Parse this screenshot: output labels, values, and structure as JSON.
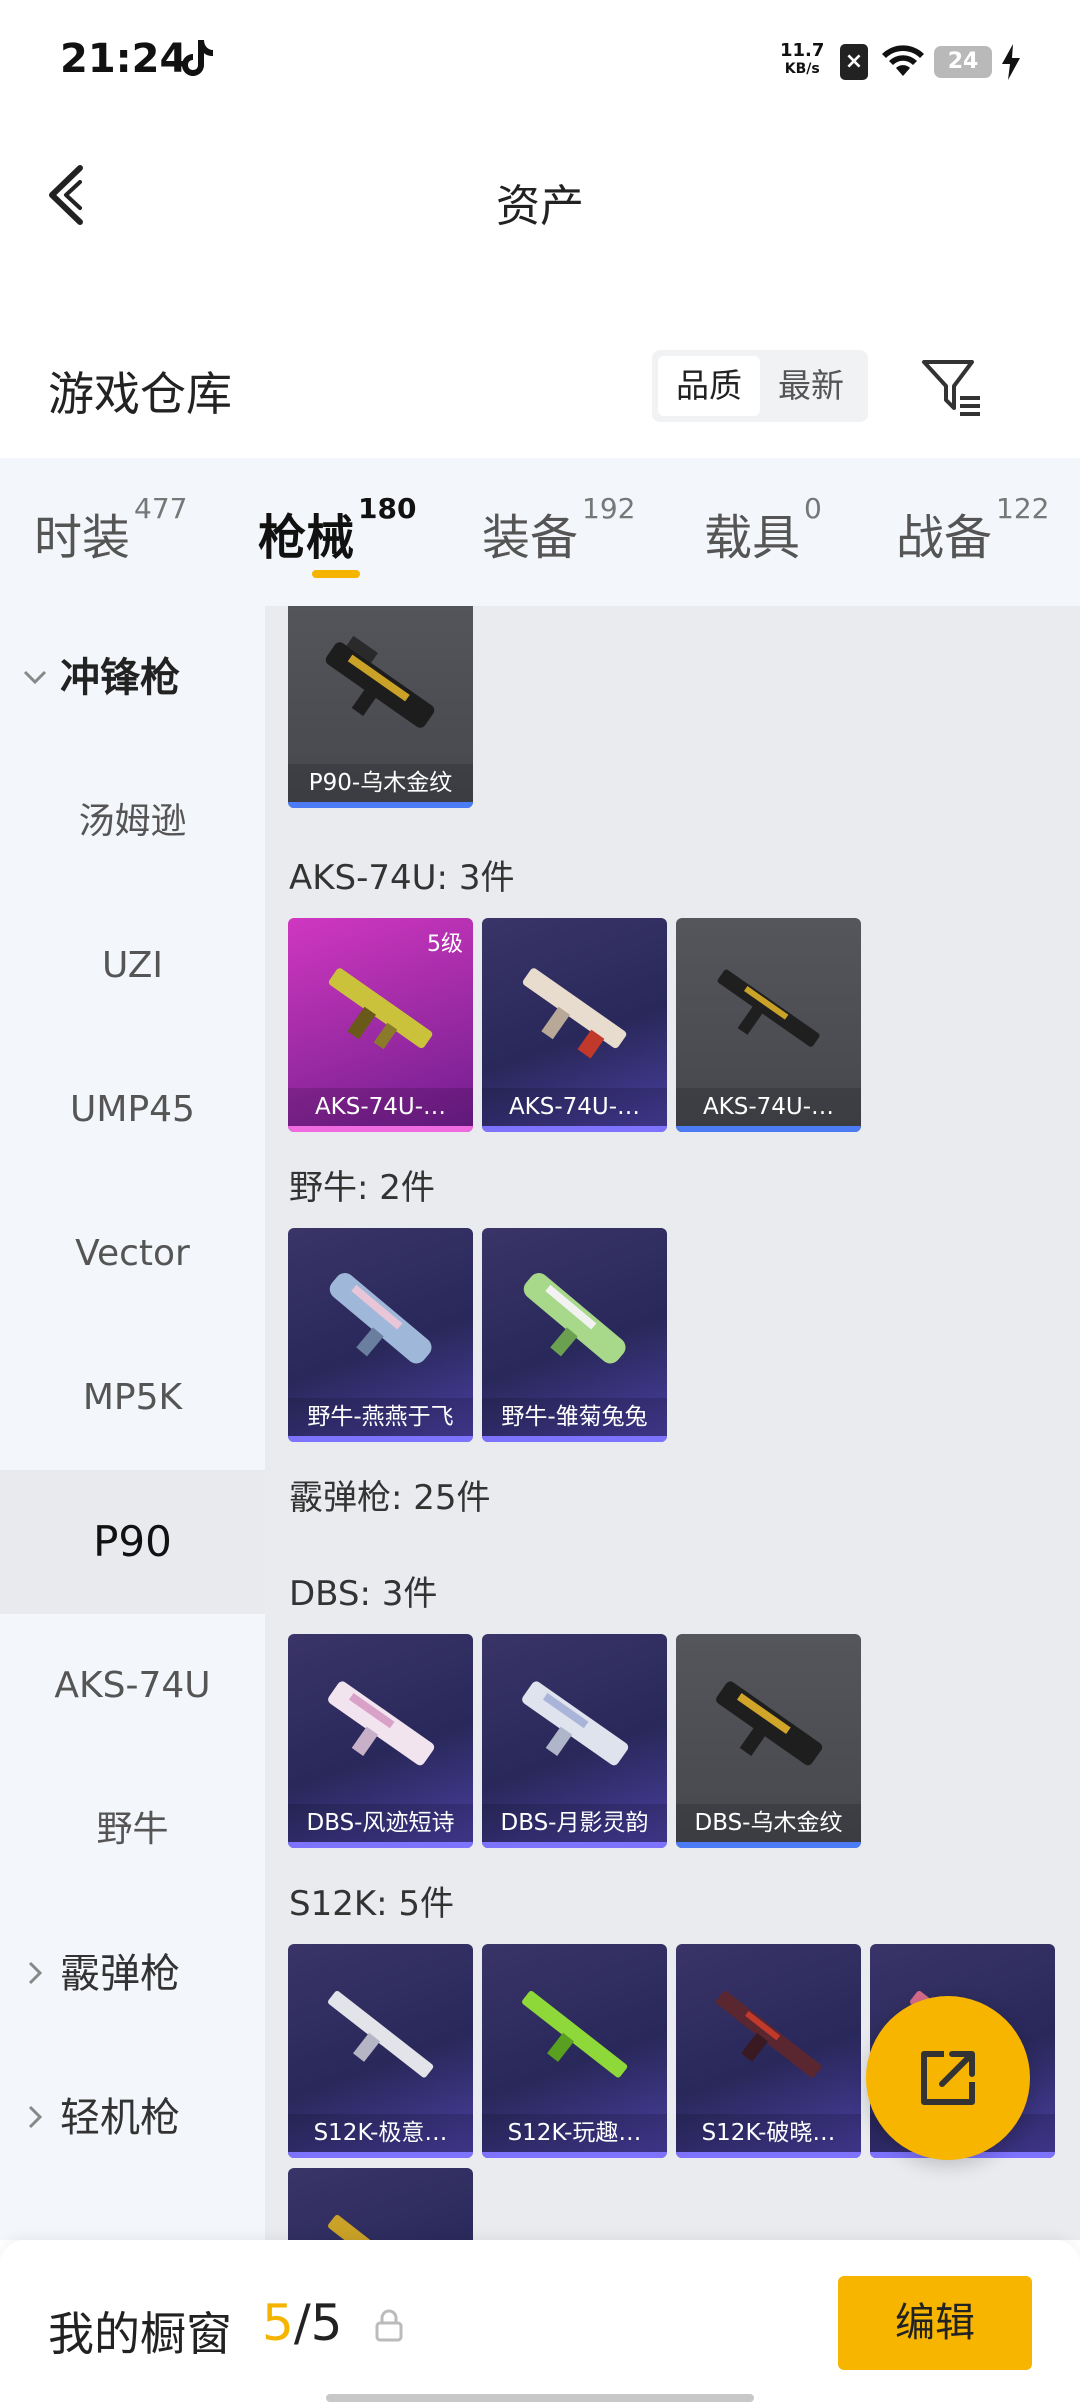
{
  "status": {
    "time": "21:24",
    "net_speed_value": "11.7",
    "net_speed_unit": "KB/s",
    "battery": "24"
  },
  "header": {
    "title": "资产",
    "back_icon": "back-arrow-icon"
  },
  "section": {
    "title": "游戏仓库",
    "sort_options": [
      "品质",
      "最新"
    ],
    "sort_selected": "品质"
  },
  "tabs": [
    {
      "label": "时装",
      "count": "477",
      "active": false
    },
    {
      "label": "枪械",
      "count": "180",
      "active": true
    },
    {
      "label": "装备",
      "count": "192",
      "active": false
    },
    {
      "label": "载具",
      "count": "0",
      "active": false
    },
    {
      "label": "战备",
      "count": "122",
      "active": false
    }
  ],
  "sidebar": {
    "items": [
      {
        "label": "冲锋枪",
        "type": "group-expanded"
      },
      {
        "label": "汤姆逊",
        "type": "item"
      },
      {
        "label": "UZI",
        "type": "item"
      },
      {
        "label": "UMP45",
        "type": "item"
      },
      {
        "label": "Vector",
        "type": "item"
      },
      {
        "label": "MP5K",
        "type": "item"
      },
      {
        "label": "P90",
        "type": "selected"
      },
      {
        "label": "AKS-74U",
        "type": "item"
      },
      {
        "label": "野牛",
        "type": "item"
      },
      {
        "label": "霰弹枪",
        "type": "group-collapsed"
      },
      {
        "label": "轻机枪",
        "type": "group-collapsed"
      }
    ]
  },
  "groups": {
    "p90": {
      "cards": [
        {
          "name": "P90-乌木金纹",
          "rarity": "gray"
        }
      ]
    },
    "aks": {
      "label": "AKS-74U: 3件",
      "cards": [
        {
          "name": "AKS-74U-…",
          "rarity": "pink",
          "level": "5级"
        },
        {
          "name": "AKS-74U-…",
          "rarity": "purple"
        },
        {
          "name": "AKS-74U-…",
          "rarity": "gray"
        }
      ]
    },
    "bison": {
      "label": "野牛: 2件",
      "cards": [
        {
          "name": "野牛-燕燕于飞",
          "rarity": "purple"
        },
        {
          "name": "野牛-雏菊兔兔",
          "rarity": "purple"
        }
      ]
    },
    "shotgun": {
      "label": "霰弹枪: 25件"
    },
    "dbs": {
      "label": "DBS: 3件",
      "cards": [
        {
          "name": "DBS-风迹短诗",
          "rarity": "purple"
        },
        {
          "name": "DBS-月影灵韵",
          "rarity": "purple"
        },
        {
          "name": "DBS-乌木金纹",
          "rarity": "gray"
        }
      ]
    },
    "s12k": {
      "label": "S12K: 5件",
      "cards": [
        {
          "name": "S12K-极意…",
          "rarity": "purple"
        },
        {
          "name": "S12K-玩趣…",
          "rarity": "purple"
        },
        {
          "name": "S12K-破晓…",
          "rarity": "purple"
        },
        {
          "name": "…",
          "rarity": "purple"
        },
        {
          "name": "",
          "rarity": "purple"
        }
      ]
    }
  },
  "fab": {
    "icon": "share-external-icon"
  },
  "bottom": {
    "label": "我的橱窗",
    "count_current": "5",
    "count_sep_total": "/5",
    "edit_label": "编辑"
  },
  "colors": {
    "accent": "#f7b500",
    "purple_card": "#2f2d63",
    "gray_card": "#4d4f55",
    "pink_card": "#c233b6",
    "panel_bg": "#f3f6fb",
    "grid_bg": "#e9ebef"
  }
}
